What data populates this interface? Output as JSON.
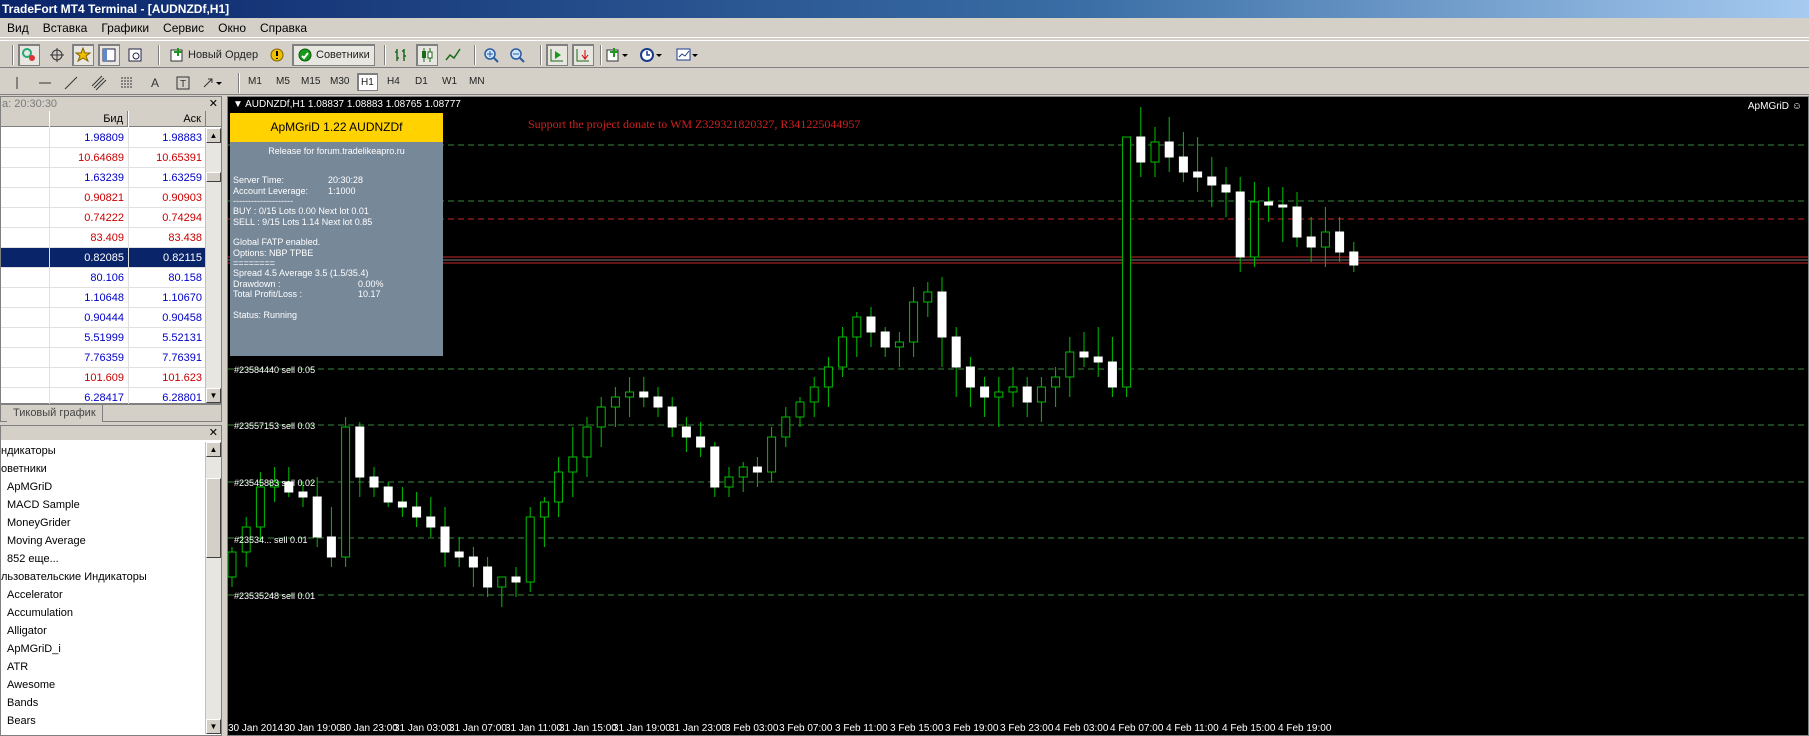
{
  "window": {
    "title": "TradeFort MT4 Terminal - [AUDNZDf,H1]"
  },
  "menu": [
    "Вид",
    "Вставка",
    "Графики",
    "Сервис",
    "Окно",
    "Справка"
  ],
  "toolbar": {
    "new_order_label": "Новый Ордер",
    "experts_label": "Советники",
    "timeframes": [
      "M1",
      "M5",
      "M15",
      "M30",
      "H1",
      "H4",
      "D1",
      "W1",
      "MN"
    ],
    "active_timeframe": "H1"
  },
  "market_watch": {
    "header": "а: 20:30:30",
    "col_bid": "Бид",
    "col_ask": "Аск",
    "rows": [
      {
        "bid": "1.98809",
        "ask": "1.98883",
        "dir": "up"
      },
      {
        "bid": "10.64689",
        "ask": "10.65391",
        "dir": "down"
      },
      {
        "bid": "1.63239",
        "ask": "1.63259",
        "dir": "up"
      },
      {
        "bid": "0.90821",
        "ask": "0.90903",
        "dir": "down"
      },
      {
        "bid": "0.74222",
        "ask": "0.74294",
        "dir": "down"
      },
      {
        "bid": "83.409",
        "ask": "83.438",
        "dir": "down"
      },
      {
        "bid": "0.82085",
        "ask": "0.82115",
        "dir": "sel"
      },
      {
        "bid": "80.106",
        "ask": "80.158",
        "dir": "up"
      },
      {
        "bid": "1.10648",
        "ask": "1.10670",
        "dir": "up"
      },
      {
        "bid": "0.90444",
        "ask": "0.90458",
        "dir": "up"
      },
      {
        "bid": "5.51999",
        "ask": "5.52131",
        "dir": "up"
      },
      {
        "bid": "7.76359",
        "ask": "7.76391",
        "dir": "up"
      },
      {
        "bid": "101.609",
        "ask": "101.623",
        "dir": "down"
      },
      {
        "bid": "6.28417",
        "ask": "6.28801",
        "dir": "up"
      }
    ],
    "tab_label": "Тиковый график"
  },
  "navigator": {
    "items": [
      "ндикаторы",
      "оветники",
      "ApMGriD",
      "MACD Sample",
      "MoneyGrider",
      "Moving Average",
      "852 еще...",
      "льзовательские Индикаторы",
      "Accelerator",
      "Accumulation",
      "Alligator",
      "ApMGriD_i",
      "ATR",
      "Awesome",
      "Bands",
      "Bears"
    ]
  },
  "chart": {
    "title_line": "AUDNZDf,H1  1.08837 1.08883 1.08765 1.08777",
    "ea_label": "ApMGriD ☺",
    "donate_text": "Support the project donate to WM Z329321820327, R341225044957",
    "panel": {
      "header": "ApMGriD 1.22 AUDNZDf",
      "release": "Release for forum.tradelikeapro.ru",
      "server_time_label": "Server Time:",
      "server_time": "20:30:28",
      "leverage_label": "Account Leverage:",
      "leverage": "1:1000",
      "dashes": "--------------------",
      "buy_line": "BUY : 0/15  Lots 0.00 Next lot 0.01",
      "sell_line": "SELL : 9/15  Lots 1.14 Next lot 0.85",
      "fatp": "Global FATP enabled.",
      "options": "Options: NBP TPBE",
      "eq": "========",
      "spread": "Spread 4.5 Average 3.5 (1.5/35.4)",
      "drawdown_label": "Drawdown :",
      "drawdown": "0.00%",
      "profit_label": "Total Profit/Loss :",
      "profit": "10.17",
      "status": "Status: Running"
    },
    "order_labels": [
      "#23584440 sell 0.05",
      "#23557153 sell 0.03",
      "#23545883 sell 0.02",
      "#23534... sell 0.01",
      "#23535248 sell 0.01"
    ],
    "time_labels": [
      "30 Jan 2014",
      "30 Jan 19:00",
      "30 Jan 23:00",
      "31 Jan 03:00",
      "31 Jan 07:00",
      "31 Jan 11:00",
      "31 Jan 15:00",
      "31 Jan 19:00",
      "31 Jan 23:00",
      "3 Feb 03:00",
      "3 Feb 07:00",
      "3 Feb 11:00",
      "3 Feb 15:00",
      "3 Feb 19:00",
      "3 Feb 23:00",
      "4 Feb 03:00",
      "4 Feb 07:00",
      "4 Feb 11:00",
      "4 Feb 15:00",
      "4 Feb 19:00"
    ],
    "colors": {
      "bull": "#00c000",
      "bear_body": "#ffffff",
      "grid": "#2a6e2a",
      "orderline": "#3a8a3a",
      "red": "#c82828",
      "panel": "#778899",
      "panel_head": "#ffd200"
    }
  }
}
